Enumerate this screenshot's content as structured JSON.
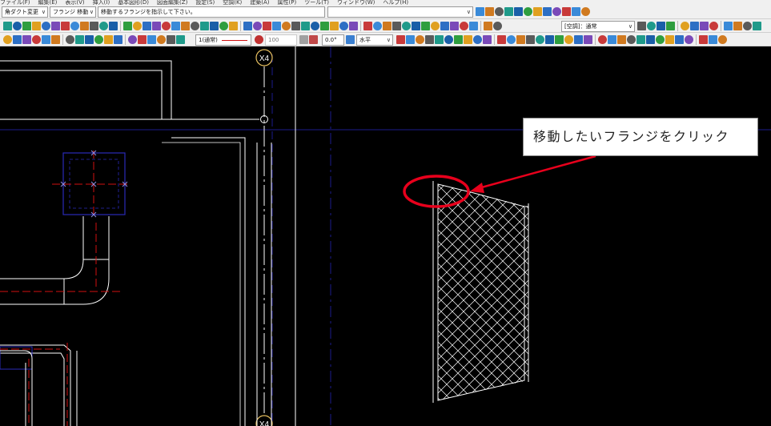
{
  "menu": {
    "items": [
      "ファイル(F)",
      "編集(E)",
      "表示(V)",
      "挿入(I)",
      "基本図形(D)",
      "図面編集(Z)",
      "設定(S)",
      "空調(K)",
      "建築(A)",
      "属性(P)",
      "ツール(T)",
      "ウィンドウ(W)",
      "ヘルプ(H)"
    ]
  },
  "cmdbar": {
    "category": "角ダクト変更",
    "command": "フランジ 移動",
    "prompt": "移動するフランジを指示して下さい。",
    "input": ""
  },
  "toolbar2": {
    "system": "[空調]：通常"
  },
  "toolbar3": {
    "linestyle": "1(通常)",
    "opacity": "100",
    "angle": "0.0°",
    "direction": "水平"
  },
  "drawing": {
    "grid_label_top": "X4",
    "grid_label_bottom": "X4"
  },
  "annotation": {
    "callout_text": "移動したいフランジをクリック",
    "highlight_color": "#e8001c"
  },
  "colors": {
    "background": "#000000",
    "duct_line": "#ffffff",
    "center_line": "#d01010",
    "grid_line": "#1c1c8c",
    "fitting_box": "#2a2ab8"
  }
}
